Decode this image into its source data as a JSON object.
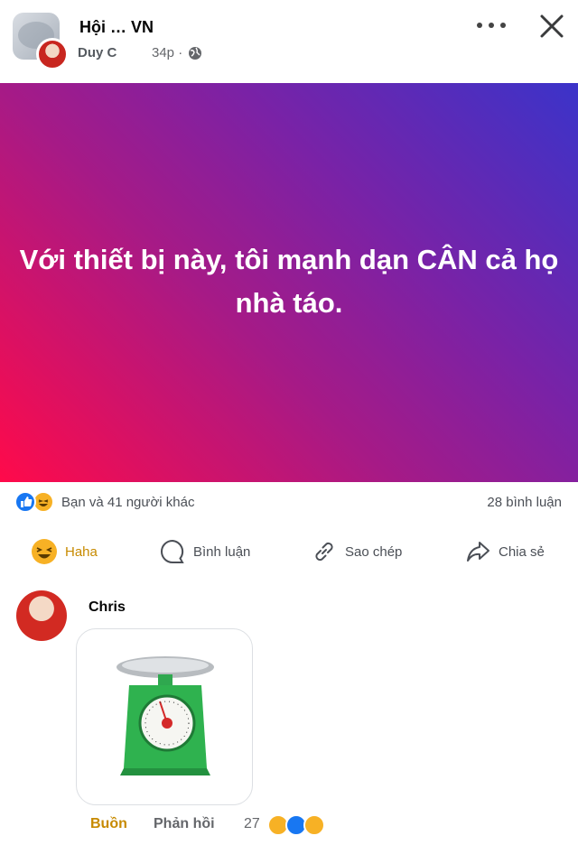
{
  "header": {
    "group_name": "Hội … VN",
    "author": "Duy C",
    "time": "34p ·"
  },
  "post": {
    "text": "Với thiết bị này, tôi mạnh dạn CÂN cả họ nhà táo.",
    "gradient": [
      "#ff0a4a",
      "#a71a86",
      "#3b33c9"
    ]
  },
  "summary": {
    "reactions_text": "Bạn và 41 người khác",
    "comments_text": "28 bình luận"
  },
  "actions": {
    "haha": "Haha",
    "comment": "Bình luận",
    "copy": "Sao chép",
    "share": "Chia sẻ"
  },
  "comment": {
    "author": "Chris",
    "reaction_label": "Buồn",
    "reply_label": "Phản hồi",
    "reaction_count": "27"
  },
  "colors": {
    "accent_haha": "#c78a00",
    "like_blue": "#1877f2",
    "haha_yellow": "#f7b125"
  }
}
